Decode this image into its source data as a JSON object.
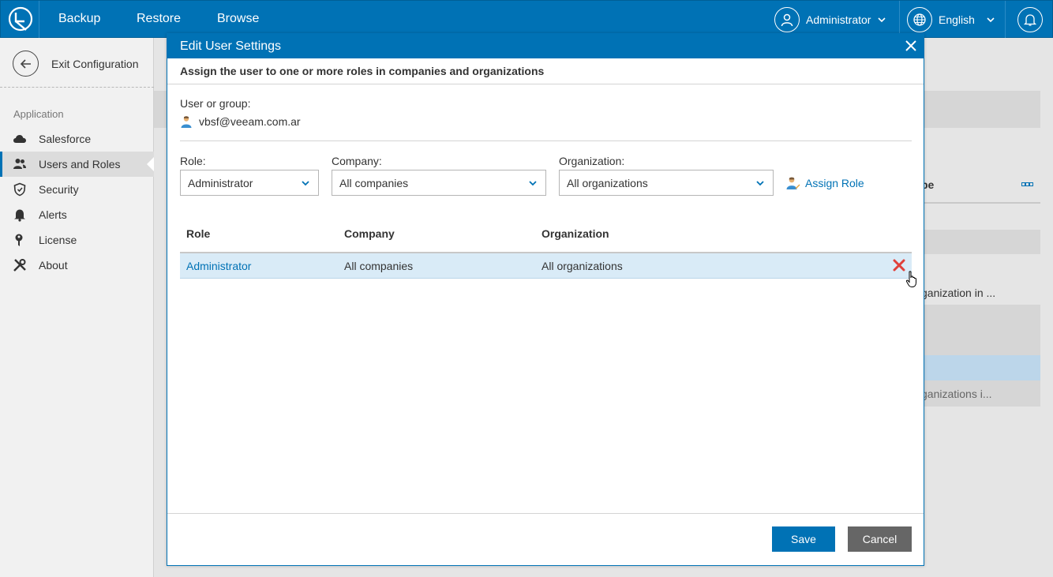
{
  "nav": {
    "items": [
      "Backup",
      "Restore",
      "Browse"
    ],
    "user": "Administrator",
    "language": "English"
  },
  "sidebar": {
    "exit_label": "Exit Configuration",
    "section": "Application",
    "items": [
      {
        "label": "Salesforce",
        "icon": "cloud-icon"
      },
      {
        "label": "Users and Roles",
        "icon": "users-icon"
      },
      {
        "label": "Security",
        "icon": "shield-icon"
      },
      {
        "label": "Alerts",
        "icon": "bell-icon"
      },
      {
        "label": "License",
        "icon": "key-icon"
      },
      {
        "label": "About",
        "icon": "tools-icon"
      }
    ]
  },
  "background": {
    "col_header_fragment": "pe",
    "row_fragment_1": "ganization in ...",
    "row_fragment_2": "ganizations i..."
  },
  "dialog": {
    "title": "Edit User Settings",
    "subtitle": "Assign the user to one or more roles in companies and organizations",
    "user_group_label": "User or group:",
    "user_value": "vbsf@veeam.com.ar",
    "role_label": "Role:",
    "role_value": "Administrator",
    "company_label": "Company:",
    "company_value": "All companies",
    "org_label": "Organization:",
    "org_value": "All organizations",
    "assign_role": "Assign Role",
    "table": {
      "headers": [
        "Role",
        "Company",
        "Organization"
      ],
      "rows": [
        {
          "role": "Administrator",
          "company": "All companies",
          "organization": "All organizations"
        }
      ]
    },
    "save_label": "Save",
    "cancel_label": "Cancel"
  },
  "colors": {
    "accent": "#0072b5",
    "selected_row": "#d9ebf7",
    "delete": "#e0403a"
  }
}
